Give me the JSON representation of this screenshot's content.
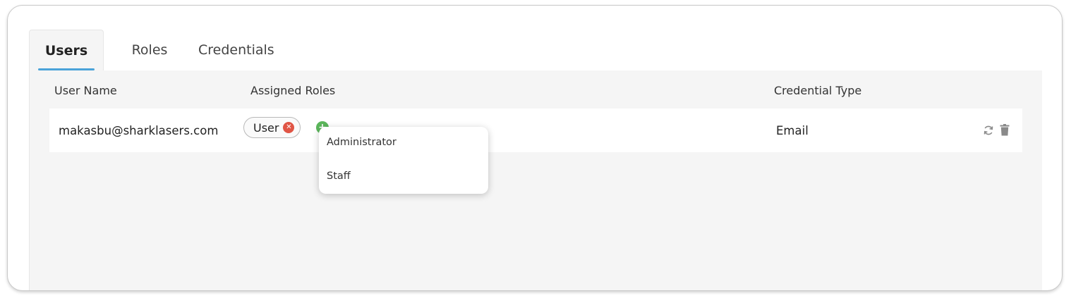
{
  "tabs": [
    {
      "label": "Users",
      "active": true
    },
    {
      "label": "Roles",
      "active": false
    },
    {
      "label": "Credentials",
      "active": false
    }
  ],
  "table": {
    "columns": [
      "User Name",
      "Assigned Roles",
      "Credential Type"
    ],
    "rows": [
      {
        "user_name": "makasbu@sharklasers.com",
        "roles": [
          "User"
        ],
        "credential_type": "Email"
      }
    ]
  },
  "role_dropdown": {
    "options": [
      "Administrator",
      "Staff"
    ]
  },
  "icons": {
    "remove_role": "close-circle-icon",
    "add_role": "plus-circle-icon",
    "refresh": "refresh-icon",
    "delete": "trash-icon"
  },
  "colors": {
    "accent": "#4aa3d9",
    "remove": "#e05545",
    "add": "#5bb65b"
  }
}
